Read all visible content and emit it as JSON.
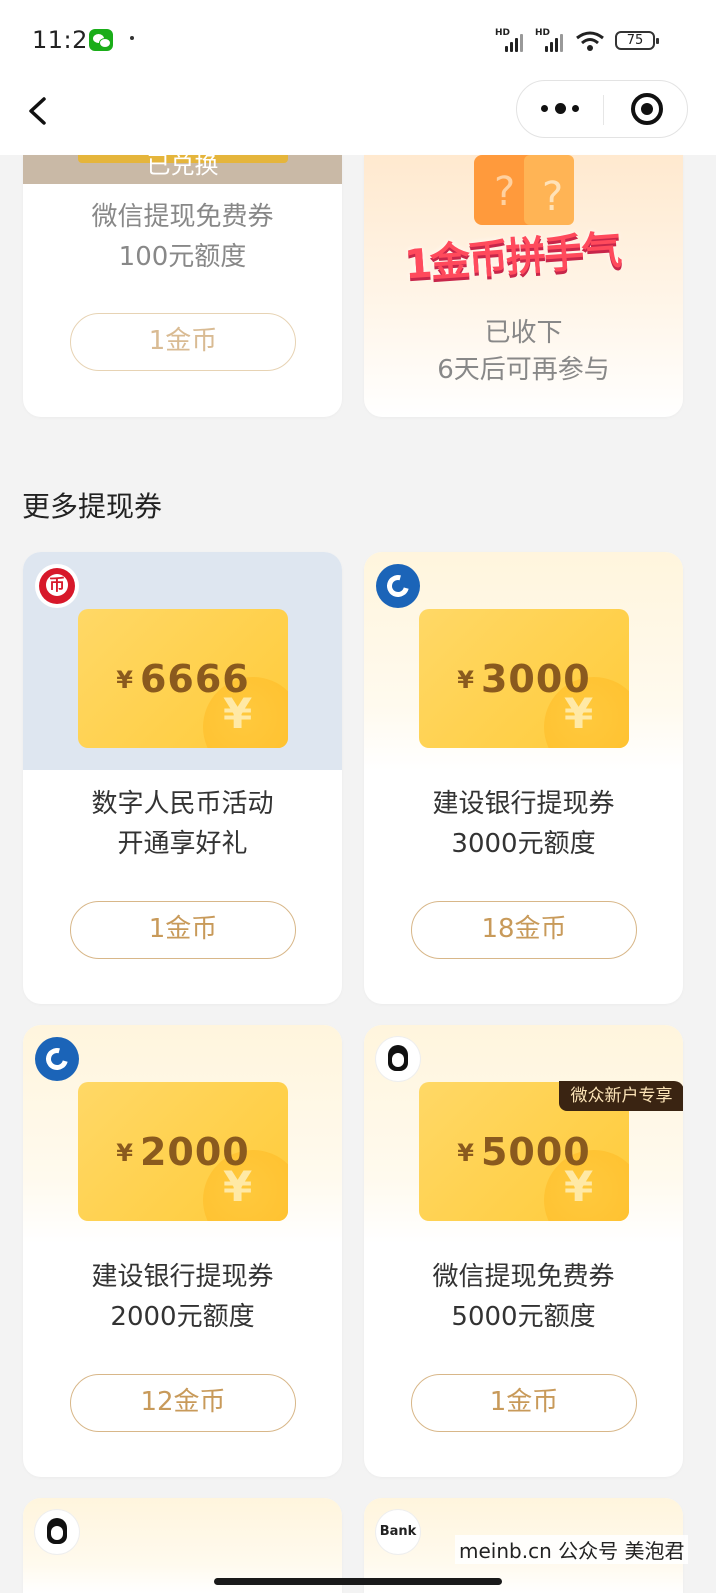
{
  "status_bar": {
    "time": "11:21",
    "battery": "75",
    "network_a": "HD",
    "network_b": "HD"
  },
  "redeemed_card": {
    "ribbon": "已兑换",
    "title_line1": "微信提现免费券",
    "title_line2": "100元额度",
    "button": "1金币"
  },
  "lucky_card": {
    "banner_text": "1金币拼手气",
    "status_line1": "已收下",
    "status_line2": "6天后可再参与"
  },
  "section": {
    "title": "更多提现券"
  },
  "coupons": [
    {
      "logo": "digital-rmb-logo",
      "currency": "¥",
      "amount": "6666",
      "title_line1": "数字人民币活动",
      "title_line2": "开通享好礼",
      "button": "1金币",
      "coin_symbol": "¥"
    },
    {
      "logo": "ccb-logo",
      "currency": "¥",
      "amount": "3000",
      "title_line1": "建设银行提现券",
      "title_line2": "3000元额度",
      "button": "18金币",
      "coin_symbol": "¥"
    },
    {
      "logo": "ccb-logo",
      "currency": "¥",
      "amount": "2000",
      "title_line1": "建设银行提现券",
      "title_line2": "2000元额度",
      "button": "12金币",
      "coin_symbol": "¥"
    },
    {
      "logo": "webank-logo",
      "currency": "¥",
      "amount": "5000",
      "badge": "微众新户专享",
      "title_line1": "微信提现免费券",
      "title_line2": "5000元额度",
      "button": "1金币",
      "coin_symbol": "¥"
    }
  ],
  "partial_cards": [
    {
      "logo": "penguin-logo"
    },
    {
      "logo": "bank-logo",
      "label": "Bank"
    }
  ],
  "watermark": "meinb.cn  公众号 美泡君",
  "colors": {
    "accent": "#c89a5a",
    "coupon_gold": "#ffcb3a",
    "blue_bg": "#dee6f0"
  }
}
